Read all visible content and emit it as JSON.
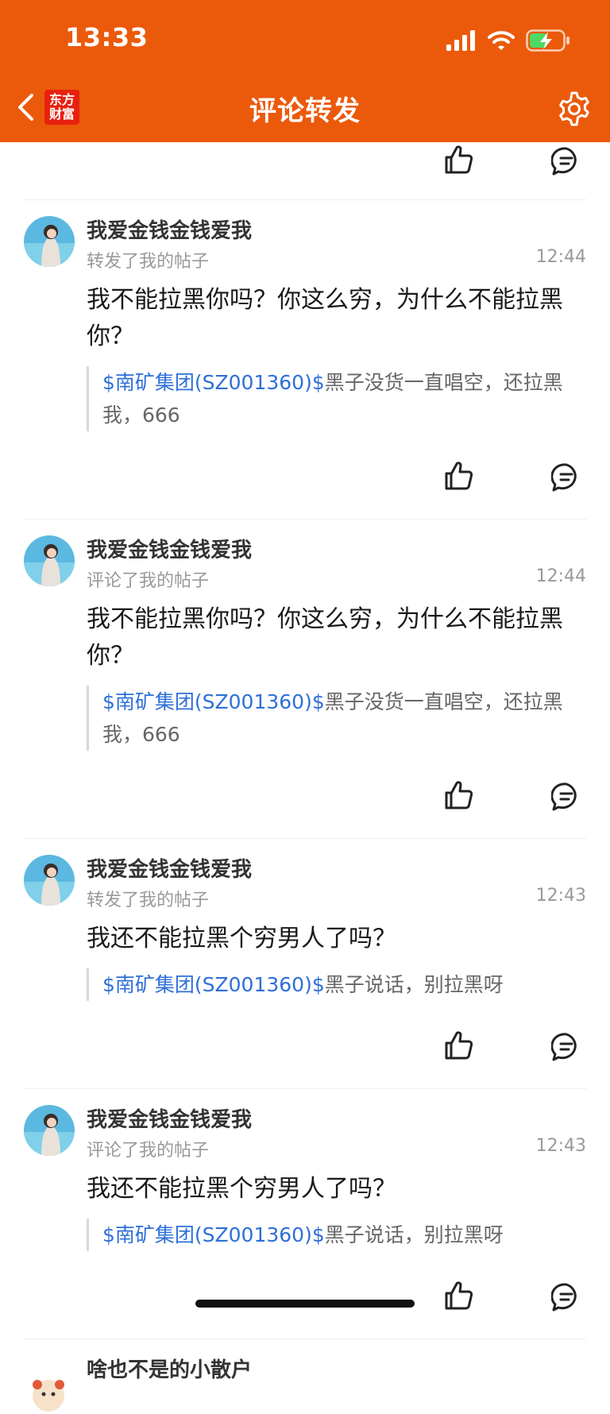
{
  "status_bar": {
    "time": "13:33"
  },
  "header": {
    "title": "评论转发",
    "logo_line1": "东方",
    "logo_line2": "财富"
  },
  "colors": {
    "brand": "#EB5A0B",
    "logo": "#E8210F",
    "stock_link": "#2E6FD8"
  },
  "posts": [
    {
      "user": "我爱金钱金钱爱我",
      "action": "转发了我的帖子",
      "time": "12:44",
      "content": "我不能拉黑你吗？你这么穷，为什么不能拉黑你？",
      "quote_stock": "$南矿集团(SZ001360)$",
      "quote_text": "黑子没货一直唱空，还拉黑我，666"
    },
    {
      "user": "我爱金钱金钱爱我",
      "action": "评论了我的帖子",
      "time": "12:44",
      "content": "我不能拉黑你吗？你这么穷，为什么不能拉黑你？",
      "quote_stock": "$南矿集团(SZ001360)$",
      "quote_text": "黑子没货一直唱空，还拉黑我，666"
    },
    {
      "user": "我爱金钱金钱爱我",
      "action": "转发了我的帖子",
      "time": "12:43",
      "content": "我还不能拉黑个穷男人了吗？",
      "quote_stock": "$南矿集团(SZ001360)$",
      "quote_text": "黑子说话，别拉黑呀"
    },
    {
      "user": "我爱金钱金钱爱我",
      "action": "评论了我的帖子",
      "time": "12:43",
      "content": "我还不能拉黑个穷男人了吗？",
      "quote_stock": "$南矿集团(SZ001360)$",
      "quote_text": "黑子说话，别拉黑呀"
    }
  ],
  "partial_post": {
    "user": "啥也不是的小散户"
  },
  "icons": {
    "back": "chevron-left-icon",
    "settings": "gear-icon",
    "like": "thumbs-up-icon",
    "comment": "comment-bubble-icon",
    "signal": "cellular-signal-icon",
    "wifi": "wifi-icon",
    "battery": "battery-charging-icon"
  }
}
